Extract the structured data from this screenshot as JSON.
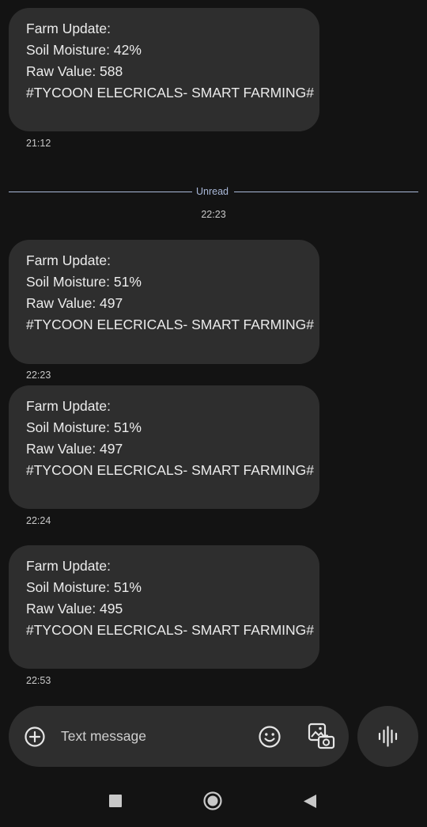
{
  "messages": [
    {
      "lines": [
        "Farm Update:",
        "Soil Moisture: 42%",
        "Raw Value: 588",
        "#TYCOON ELECRICALS- SMART FARMING#"
      ],
      "time": "21:12"
    },
    {
      "lines": [
        "Farm Update:",
        "Soil Moisture: 51%",
        "Raw Value: 497",
        "#TYCOON ELECRICALS- SMART FARMING#"
      ],
      "time": "22:23"
    },
    {
      "lines": [
        "Farm Update:",
        "Soil Moisture: 51%",
        "Raw Value: 497",
        "#TYCOON ELECRICALS- SMART FARMING#"
      ],
      "time": "22:24"
    },
    {
      "lines": [
        "Farm Update:",
        "Soil Moisture: 51%",
        "Raw Value: 495",
        "#TYCOON ELECRICALS- SMART FARMING#"
      ],
      "time": "22:53"
    }
  ],
  "unread_divider": {
    "label": "Unread",
    "time": "22:23"
  },
  "composer": {
    "placeholder": "Text message",
    "icons": [
      "add-icon",
      "emoji-icon",
      "gallery-icon",
      "voice-icon"
    ]
  },
  "nav": {
    "icons": [
      "recents-icon",
      "home-icon",
      "back-icon"
    ]
  },
  "colors": {
    "background": "#131313",
    "bubble": "#2e2e2e",
    "divider": "#a9b8d8"
  }
}
